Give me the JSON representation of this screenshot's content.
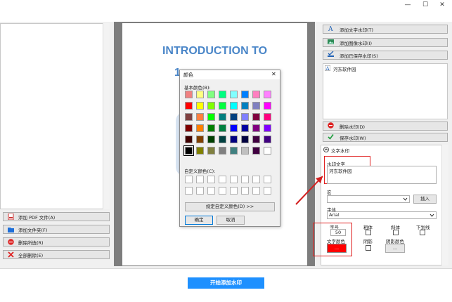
{
  "window": {
    "minimize_glyph": "—",
    "maximize_glyph": "☐",
    "close_glyph": "✕"
  },
  "left_panel": {
    "buttons": [
      {
        "label": "添加 PDF 文件(A)",
        "icon": "pdf-file-icon"
      },
      {
        "label": "添加文件夹(F)",
        "icon": "folder-icon"
      },
      {
        "label": "删除所选(R)",
        "icon": "remove-icon"
      },
      {
        "label": "全部删除(E)",
        "icon": "delete-all-icon"
      }
    ]
  },
  "preview": {
    "title_line1": "INTRODUCTION TO",
    "title_line2": "1"
  },
  "color_dialog": {
    "title": "颜色",
    "close_glyph": "✕",
    "basic_colors_label": "基本颜色(B):",
    "basic_colors": [
      [
        "#f08080",
        "#ffff80",
        "#80ff80",
        "#00ff80",
        "#80ffff",
        "#0080ff",
        "#ff80c0",
        "#ff80ff"
      ],
      [
        "#ff0000",
        "#ffff00",
        "#80ff00",
        "#00ff40",
        "#00ffff",
        "#0080c0",
        "#8080c0",
        "#ff00ff"
      ],
      [
        "#804040",
        "#ff8040",
        "#00ff00",
        "#008080",
        "#004080",
        "#8080ff",
        "#800040",
        "#ff0080"
      ],
      [
        "#800000",
        "#ff8000",
        "#008000",
        "#008040",
        "#0000ff",
        "#0000a0",
        "#800080",
        "#8000ff"
      ],
      [
        "#400000",
        "#804000",
        "#004000",
        "#004040",
        "#000080",
        "#000040",
        "#400040",
        "#400080"
      ],
      [
        "#000000",
        "#808000",
        "#808040",
        "#808080",
        "#408080",
        "#c0c0c0",
        "#400040",
        "#ffffff"
      ]
    ],
    "custom_colors_label": "自定义颜色(C):",
    "define_custom_label": "规定自定义颜色(D) >>",
    "ok_label": "确定",
    "cancel_label": "取消"
  },
  "right_panel": {
    "buttons": [
      {
        "label": "添加文字水印(T)",
        "icon": "text-watermark-icon"
      },
      {
        "label": "添加图像水印(I)",
        "icon": "image-watermark-icon"
      },
      {
        "label": "添加已保存水印(S)",
        "icon": "saved-watermark-icon"
      }
    ],
    "watermark_list": [
      {
        "label": "河东软件园",
        "icon": "text-watermark-icon"
      }
    ],
    "delete_label": "删除水印(D)",
    "save_label": "保存水印(W)",
    "section_title": "文字水印",
    "watermark_text_label": "水印文字",
    "watermark_text_value": "河东软件园",
    "macro_label": "宏",
    "insert_label": "插入",
    "font_label": "字体",
    "font_value": "Arial",
    "size_label": "字号",
    "size_value": "50",
    "bold_label": "粗体",
    "italic_label": "斜体",
    "underline_label": "下划线",
    "text_color_label": "文字颜色",
    "text_color_button": "...",
    "text_color": "#ff0000",
    "shadow_label": "阴影",
    "shadow_color_label": "阴影颜色",
    "shadow_color_button": "..."
  },
  "bottom": {
    "start_label": "开始添加水印"
  }
}
